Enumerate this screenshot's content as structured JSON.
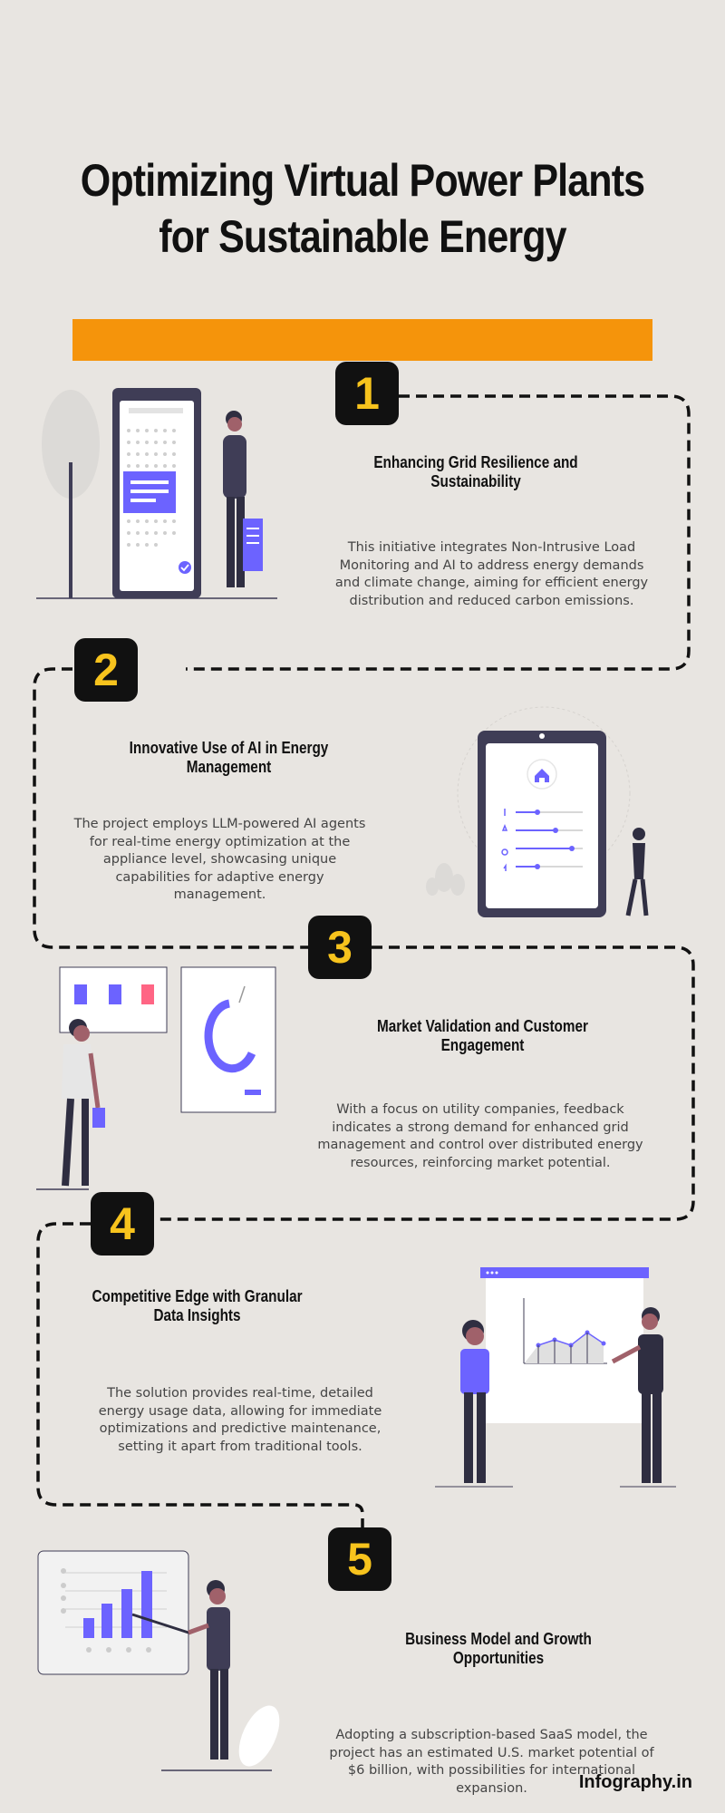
{
  "title": {
    "line1": "Optimizing Virtual Power Plants",
    "line2": "for Sustainable Energy"
  },
  "colors": {
    "accent": "#f5940b",
    "number_bg": "#111111",
    "number_fg": "#f7c31d",
    "illustration": "#6c63ff"
  },
  "sections": [
    {
      "number": "1",
      "heading": "Enhancing Grid Resilience and Sustainability",
      "description": "This initiative integrates Non-Intrusive Load Monitoring and AI to address energy demands and climate change, aiming for efficient energy distribution and reduced carbon emissions.",
      "illustration": "phone-person-illustration"
    },
    {
      "number": "2",
      "heading": "Innovative Use of AI in Energy Management",
      "description": "The project employs LLM-powered AI agents for real-time energy optimization at the appliance level, showcasing unique capabilities for adaptive energy management.",
      "illustration": "tablet-smart-home-illustration"
    },
    {
      "number": "3",
      "heading": "Market Validation and Customer Engagement",
      "description": "With a focus on utility companies, feedback indicates a strong demand for enhanced grid management and control over distributed energy resources, reinforcing market potential.",
      "illustration": "board-presentation-illustration"
    },
    {
      "number": "4",
      "heading": "Competitive Edge with Granular Data Insights",
      "description": "The solution provides real-time, detailed energy usage data, allowing for immediate optimizations and predictive maintenance, setting it apart from traditional tools.",
      "illustration": "chart-discussion-illustration"
    },
    {
      "number": "5",
      "heading": "Business Model and Growth Opportunities",
      "description": "Adopting a subscription-based SaaS model, the project has an estimated U.S. market potential of $6 billion, with possibilities for international expansion.",
      "illustration": "bar-chart-presenter-illustration"
    }
  ],
  "footer": {
    "brand": "Infography.in"
  }
}
